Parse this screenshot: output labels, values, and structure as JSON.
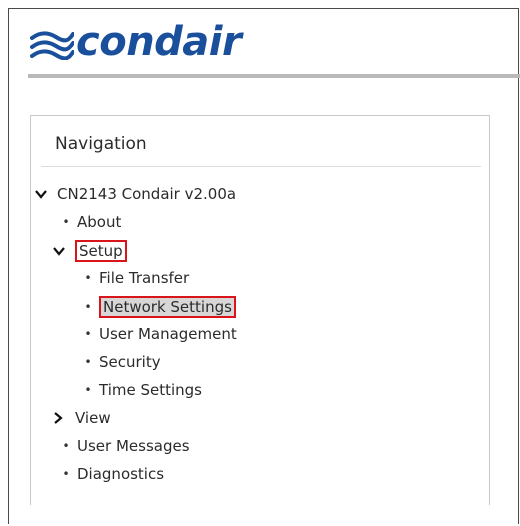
{
  "brand": {
    "logo_text": "condair",
    "logo_color": "#1a4f9c"
  },
  "navigation": {
    "title": "Navigation",
    "root": {
      "label": "CN2143 Condair v2.00a",
      "expanded": true
    },
    "items": [
      {
        "label": "About",
        "icon": "bullet-icon"
      },
      {
        "label": "Setup",
        "icon": "chevron-down-icon",
        "expanded": true,
        "highlighted": true
      },
      {
        "label": "File Transfer",
        "icon": "bullet-icon"
      },
      {
        "label": "Network Settings",
        "icon": "bullet-icon",
        "selected": true,
        "highlighted": true
      },
      {
        "label": "User Management",
        "icon": "bullet-icon"
      },
      {
        "label": "Security",
        "icon": "bullet-icon"
      },
      {
        "label": "Time Settings",
        "icon": "bullet-icon"
      },
      {
        "label": "View",
        "icon": "chevron-right-icon",
        "expanded": false
      },
      {
        "label": "User Messages",
        "icon": "bullet-icon"
      },
      {
        "label": "Diagnostics",
        "icon": "bullet-icon"
      }
    ],
    "highlight_color": "#d9141b"
  }
}
